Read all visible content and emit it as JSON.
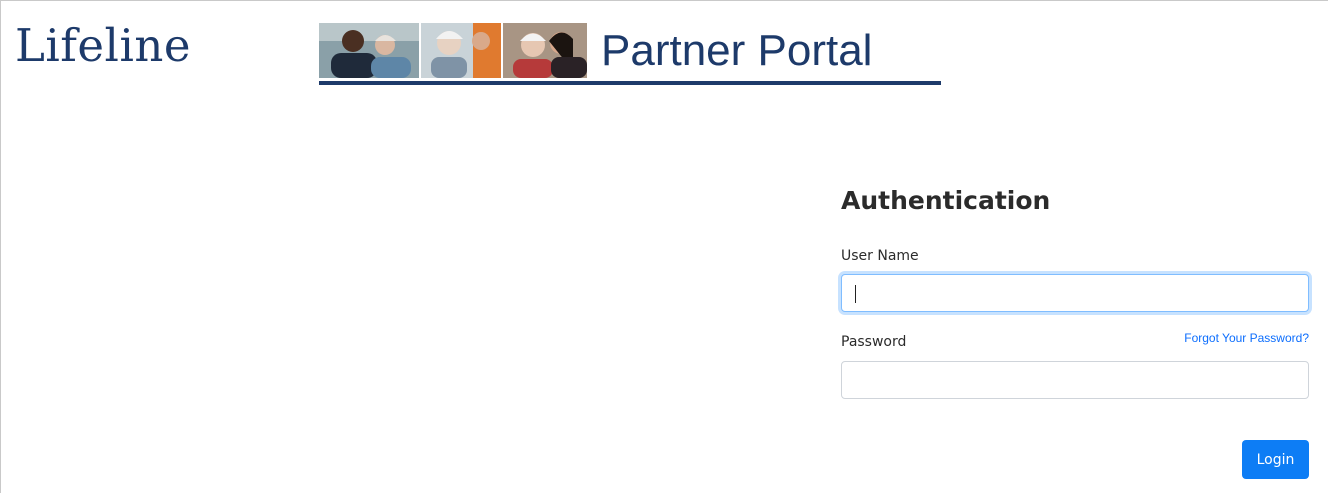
{
  "brand": {
    "logo_text": "Lifeline"
  },
  "banner": {
    "title": "Partner Portal"
  },
  "auth": {
    "title": "Authentication",
    "username_label": "User Name",
    "username_value": "",
    "password_label": "Password",
    "password_value": "",
    "forgot_link": "Forgot Your Password?",
    "login_label": "Login"
  },
  "colors": {
    "brand_navy": "#1d3a6a",
    "accent_blue": "#0d7df5",
    "link_blue": "#0d6efd",
    "focus_border": "#80bdff"
  }
}
